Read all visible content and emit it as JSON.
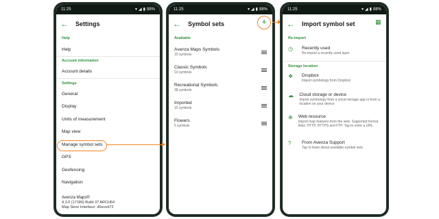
{
  "status": {
    "time": "11:25",
    "battery": "88%"
  },
  "screen1": {
    "title": "Settings",
    "sections": [
      {
        "header": "Help",
        "items": [
          "Help"
        ]
      },
      {
        "header": "Account information",
        "items": [
          "Account details"
        ]
      },
      {
        "header": "Settings",
        "items": [
          "General",
          "Display",
          "Units of measurement",
          "Map view",
          "Manage symbol sets",
          "GPS",
          "Geofencing",
          "Navigation"
        ]
      }
    ],
    "footer": {
      "name": "Avenza Maps®",
      "version": "4.3.0 (17186) Build 37 ARCH64",
      "store": "Map Store Interface: d6eced72"
    }
  },
  "screen2": {
    "title": "Symbol sets",
    "section": "Available",
    "sets": [
      {
        "name": "Avenza Maps Symbols",
        "count": "10 symbols"
      },
      {
        "name": "Classic Symbols",
        "count": "10 symbols"
      },
      {
        "name": "Recreational Symbols",
        "count": "38 symbols"
      },
      {
        "name": "Imported",
        "count": "15 symbols"
      },
      {
        "name": "Flowers",
        "count": "5 symbols"
      }
    ]
  },
  "screen3": {
    "title": "Import symbol set",
    "section1": "Re-import",
    "recent": {
      "title": "Recently used",
      "desc": "Re-import a recently used layer"
    },
    "section2": "Storage location",
    "options": [
      {
        "icon": "dropbox-icon",
        "glyph": "❖",
        "title": "Dropbox",
        "desc": "Import symbology from Dropbox"
      },
      {
        "icon": "cloud-icon",
        "glyph": "☁",
        "title": "Cloud storage or device",
        "desc": "Import symbology from a cloud storage app or from a location on your device"
      },
      {
        "icon": "globe-icon",
        "glyph": "⊕",
        "title": "Web resource",
        "desc": "Import map features from the web. Supported format links: HTTP, HTTPS and FTP. Tap to enter a URL."
      },
      {
        "icon": "help-circle-icon",
        "glyph": "?",
        "title": "From Avenza Support",
        "desc": "Tap to learn about available symbol sets"
      }
    ]
  },
  "colors": {
    "accent": "#2f8f3c",
    "highlight": "#f08428",
    "statusbar": "#0f1a14"
  }
}
